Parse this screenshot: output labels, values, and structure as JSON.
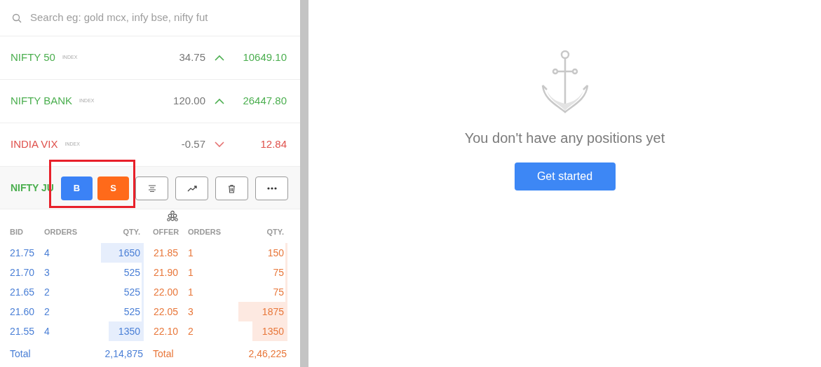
{
  "search": {
    "placeholder": "Search eg: gold mcx, infy bse, nifty fut"
  },
  "watchlist": [
    {
      "name": "NIFTY 50",
      "tag": "INDEX",
      "change": "34.75",
      "rising": true,
      "price": "10649.10"
    },
    {
      "name": "NIFTY BANK",
      "tag": "INDEX",
      "change": "120.00",
      "rising": true,
      "price": "26447.80"
    },
    {
      "name": "INDIA VIX",
      "tag": "INDEX",
      "change": "-0.57",
      "rising": false,
      "price": "12.84"
    }
  ],
  "selected_row": {
    "name": "NIFTY JU",
    "rising": true,
    "actions": [
      {
        "kind": "buy",
        "label": "B"
      },
      {
        "kind": "sell",
        "label": "S"
      },
      {
        "kind": "depth"
      },
      {
        "kind": "chart"
      },
      {
        "kind": "delete"
      },
      {
        "kind": "more"
      }
    ]
  },
  "depth": {
    "columns": [
      "BID",
      "ORDERS",
      "QTY.",
      "OFFER",
      "ORDERS",
      "QTY."
    ],
    "bids": [
      {
        "price": "21.75",
        "orders": "4",
        "qty": "1650"
      },
      {
        "price": "21.70",
        "orders": "3",
        "qty": "525"
      },
      {
        "price": "21.65",
        "orders": "2",
        "qty": "525"
      },
      {
        "price": "21.60",
        "orders": "2",
        "qty": "525"
      },
      {
        "price": "21.55",
        "orders": "4",
        "qty": "1350"
      }
    ],
    "offers": [
      {
        "price": "21.85",
        "orders": "1",
        "qty": "150"
      },
      {
        "price": "21.90",
        "orders": "1",
        "qty": "75"
      },
      {
        "price": "22.00",
        "orders": "1",
        "qty": "75"
      },
      {
        "price": "22.05",
        "orders": "3",
        "qty": "1875"
      },
      {
        "price": "22.10",
        "orders": "2",
        "qty": "1350"
      }
    ],
    "bid_total": {
      "label": "Total",
      "value": "2,14,875"
    },
    "offer_total": {
      "label": "Total",
      "value": "2,46,225"
    }
  },
  "positions": {
    "message": "You don't have any positions yet",
    "button": "Get started"
  }
}
